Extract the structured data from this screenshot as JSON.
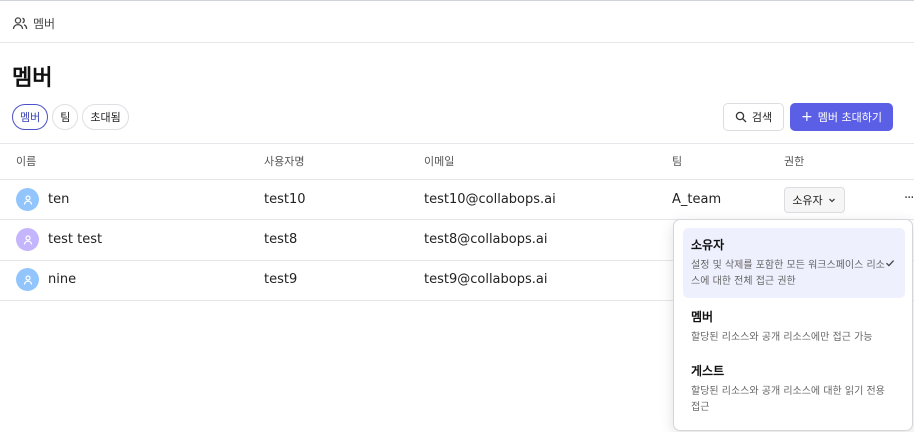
{
  "breadcrumb": {
    "icon": "users-icon",
    "label": "멤버"
  },
  "page": {
    "title": "멤버"
  },
  "tabs": [
    {
      "label": "멤버",
      "active": true
    },
    {
      "label": "팀",
      "active": false
    },
    {
      "label": "초대됨",
      "active": false
    }
  ],
  "toolbar": {
    "search_label": "검색",
    "invite_label": "멤버 초대하기",
    "accent_color": "#5b5fe6"
  },
  "table": {
    "columns": [
      "이름",
      "사용자명",
      "이메일",
      "팀",
      "권한"
    ],
    "rows": [
      {
        "name": "ten",
        "username": "test10",
        "email": "test10@collabops.ai",
        "team": "A_team",
        "role": "소유자",
        "avatar_color": "#93c5fd"
      },
      {
        "name": "test test",
        "username": "test8",
        "email": "test8@collabops.ai",
        "team": "",
        "role": "",
        "avatar_color": "#c4b5fd"
      },
      {
        "name": "nine",
        "username": "test9",
        "email": "test9@collabops.ai",
        "team": "",
        "role": "",
        "avatar_color": "#93c5fd"
      }
    ],
    "more_label": "···"
  },
  "role_menu": {
    "options": [
      {
        "title": "소유자",
        "description": "설정 및 삭제를 포함한 모든 워크스페이스 리소스에 대한 전체 접근 권한",
        "selected": true
      },
      {
        "title": "멤버",
        "description": "할당된 리소스와 공개 리소스에만 접근 가능",
        "selected": false
      },
      {
        "title": "게스트",
        "description": "할당된 리소스와 공개 리소스에 대한 읽기 전용 접근",
        "selected": false
      }
    ]
  }
}
